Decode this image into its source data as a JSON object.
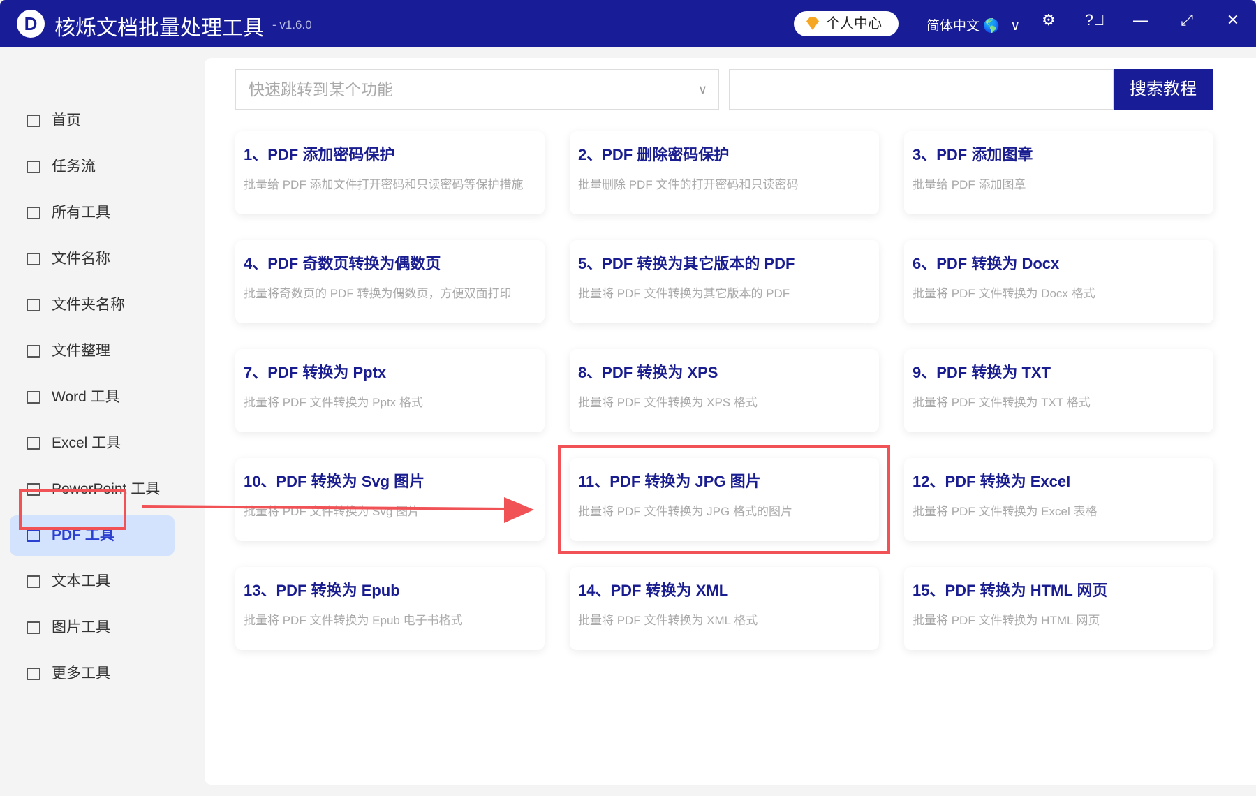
{
  "app": {
    "title": "核烁文档批量处理工具",
    "version": "- v1.6.0",
    "logo": "D",
    "user_center": "个人中心",
    "language": "简体中文"
  },
  "sidebar": {
    "items": [
      {
        "label": "首页",
        "icon": "home-icon"
      },
      {
        "label": "任务流",
        "icon": "workflow-icon"
      },
      {
        "label": "所有工具",
        "icon": "monitor-icon"
      },
      {
        "label": "文件名称",
        "icon": "file-copy-icon"
      },
      {
        "label": "文件夹名称",
        "icon": "folder-icon"
      },
      {
        "label": "文件整理",
        "icon": "organize-icon"
      },
      {
        "label": "Word 工具",
        "icon": "word-file-icon"
      },
      {
        "label": "Excel 工具",
        "icon": "excel-file-icon"
      },
      {
        "label": "PowerPoint 工具",
        "icon": "ppt-file-icon"
      },
      {
        "label": "PDF 工具",
        "icon": "pdf-file-icon",
        "active": true
      },
      {
        "label": "文本工具",
        "icon": "text-file-icon"
      },
      {
        "label": "图片工具",
        "icon": "image-icon"
      },
      {
        "label": "更多工具",
        "icon": "grid-icon"
      }
    ]
  },
  "search": {
    "jump_placeholder": "快速跳转到某个功能",
    "search_value": "",
    "search_button": "搜索教程"
  },
  "cards": [
    {
      "title": "1、PDF 添加密码保护",
      "desc": "批量给 PDF 添加文件打开密码和只读密码等保护措施"
    },
    {
      "title": "2、PDF 删除密码保护",
      "desc": "批量删除 PDF 文件的打开密码和只读密码"
    },
    {
      "title": "3、PDF 添加图章",
      "desc": "批量给 PDF 添加图章"
    },
    {
      "title": "4、PDF 奇数页转换为偶数页",
      "desc": "批量将奇数页的 PDF 转换为偶数页，方便双面打印"
    },
    {
      "title": "5、PDF 转换为其它版本的 PDF",
      "desc": "批量将 PDF 文件转换为其它版本的 PDF"
    },
    {
      "title": "6、PDF 转换为 Docx",
      "desc": "批量将 PDF 文件转换为 Docx 格式"
    },
    {
      "title": "7、PDF 转换为 Pptx",
      "desc": "批量将 PDF 文件转换为 Pptx 格式"
    },
    {
      "title": "8、PDF 转换为 XPS",
      "desc": "批量将 PDF 文件转换为 XPS 格式"
    },
    {
      "title": "9、PDF 转换为 TXT",
      "desc": "批量将 PDF 文件转换为 TXT 格式"
    },
    {
      "title": "10、PDF 转换为 Svg 图片",
      "desc": "批量将 PDF 文件转换为 Svg 图片"
    },
    {
      "title": "11、PDF 转换为 JPG 图片",
      "desc": "批量将 PDF 文件转换为 JPG 格式的图片"
    },
    {
      "title": "12、PDF 转换为 Excel",
      "desc": "批量将 PDF 文件转换为 Excel 表格"
    },
    {
      "title": "13、PDF 转换为 Epub",
      "desc": "批量将 PDF 文件转换为 Epub 电子书格式"
    },
    {
      "title": "14、PDF 转换为 XML",
      "desc": "批量将 PDF 文件转换为 XML 格式"
    },
    {
      "title": "15、PDF 转换为 HTML 网页",
      "desc": "批量将 PDF 文件转换为 HTML 网页"
    }
  ],
  "colors": {
    "brand": "#181c96",
    "highlight": "#f05256",
    "active_bg": "#d3e3fd"
  }
}
